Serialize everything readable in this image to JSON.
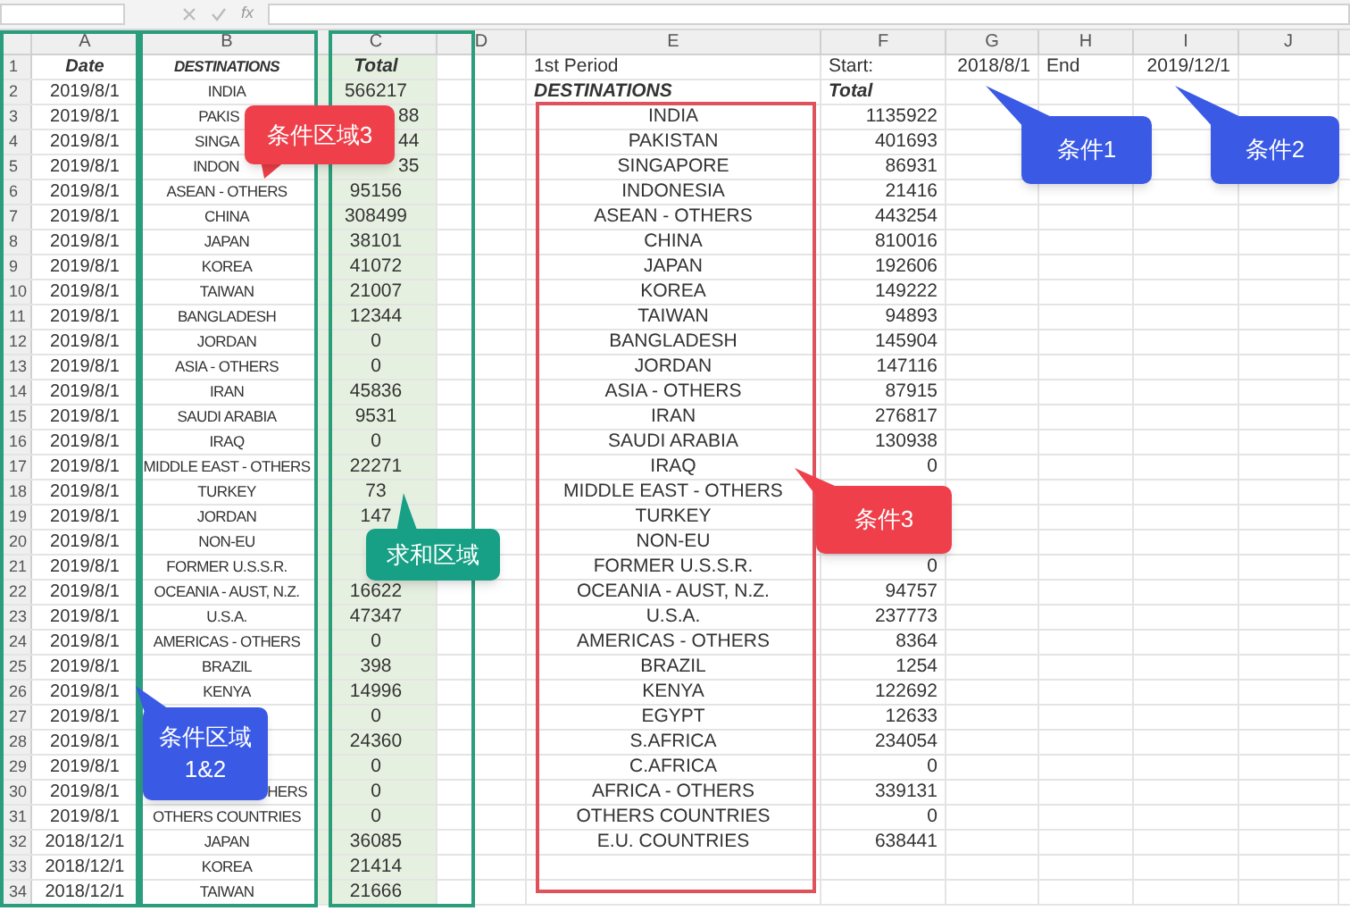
{
  "formula_bar": {
    "fx": "fx"
  },
  "columns": [
    "A",
    "B",
    "C",
    "D",
    "E",
    "F",
    "G",
    "H",
    "I",
    "J"
  ],
  "rows": [
    {
      "number": "1",
      "cells": {
        "A": "Date",
        "B": "DESTINATIONS",
        "C": "Total",
        "E": "1st Period",
        "F": "Start:",
        "G": "2018/8/1",
        "H": "End",
        "I": "2019/12/1"
      }
    },
    {
      "number": "2",
      "cells": {
        "A": "2019/8/1",
        "B": "INDIA",
        "C": "566217",
        "E": "DESTINATIONS",
        "F": "Total"
      }
    },
    {
      "number": "3",
      "cells": {
        "A": "2019/8/1",
        "B": "PAKIS",
        "C": "88",
        "E": "INDIA",
        "F": "1135922"
      }
    },
    {
      "number": "4",
      "cells": {
        "A": "2019/8/1",
        "B": "SINGA",
        "C": "44",
        "E": "PAKISTAN",
        "F": "401693"
      }
    },
    {
      "number": "5",
      "cells": {
        "A": "2019/8/1",
        "B": "INDON",
        "C": "35",
        "E": "SINGAPORE",
        "F": "86931"
      }
    },
    {
      "number": "6",
      "cells": {
        "A": "2019/8/1",
        "B": "ASEAN - OTHERS",
        "C": "95156",
        "E": "INDONESIA",
        "F": "21416"
      }
    },
    {
      "number": "7",
      "cells": {
        "A": "2019/8/1",
        "B": "CHINA",
        "C": "308499",
        "E": "ASEAN - OTHERS",
        "F": "443254"
      }
    },
    {
      "number": "8",
      "cells": {
        "A": "2019/8/1",
        "B": "JAPAN",
        "C": "38101",
        "E": "CHINA",
        "F": "810016"
      }
    },
    {
      "number": "9",
      "cells": {
        "A": "2019/8/1",
        "B": "KOREA",
        "C": "41072",
        "E": "JAPAN",
        "F": "192606"
      }
    },
    {
      "number": "10",
      "cells": {
        "A": "2019/8/1",
        "B": "TAIWAN",
        "C": "21007",
        "E": "KOREA",
        "F": "149222"
      }
    },
    {
      "number": "11",
      "cells": {
        "A": "2019/8/1",
        "B": "BANGLADESH",
        "C": "12344",
        "E": "TAIWAN",
        "F": "94893"
      }
    },
    {
      "number": "12",
      "cells": {
        "A": "2019/8/1",
        "B": "JORDAN",
        "C": "0",
        "E": "BANGLADESH",
        "F": "145904"
      }
    },
    {
      "number": "13",
      "cells": {
        "A": "2019/8/1",
        "B": "ASIA - OTHERS",
        "C": "0",
        "E": "JORDAN",
        "F": "147116"
      }
    },
    {
      "number": "14",
      "cells": {
        "A": "2019/8/1",
        "B": "IRAN",
        "C": "45836",
        "E": "ASIA - OTHERS",
        "F": "87915"
      }
    },
    {
      "number": "15",
      "cells": {
        "A": "2019/8/1",
        "B": "SAUDI ARABIA",
        "C": "9531",
        "E": "IRAN",
        "F": "276817"
      }
    },
    {
      "number": "16",
      "cells": {
        "A": "2019/8/1",
        "B": "IRAQ",
        "C": "0",
        "E": "SAUDI ARABIA",
        "F": "130938"
      }
    },
    {
      "number": "17",
      "cells": {
        "A": "2019/8/1",
        "B": "MIDDLE EAST - OTHERS",
        "C": "22271",
        "E": "IRAQ",
        "F": "0"
      }
    },
    {
      "number": "18",
      "cells": {
        "A": "2019/8/1",
        "B": "TURKEY",
        "C": "73",
        "E": "MIDDLE EAST - OTHERS"
      }
    },
    {
      "number": "19",
      "cells": {
        "A": "2019/8/1",
        "B": "JORDAN",
        "C": "147",
        "E": "TURKEY"
      }
    },
    {
      "number": "20",
      "cells": {
        "A": "2019/8/1",
        "B": "NON-EU",
        "E": "NON-EU"
      }
    },
    {
      "number": "21",
      "cells": {
        "A": "2019/8/1",
        "B": "FORMER U.S.S.R.",
        "E": "FORMER U.S.S.R.",
        "F": "0"
      }
    },
    {
      "number": "22",
      "cells": {
        "A": "2019/8/1",
        "B": "OCEANIA - AUST, N.Z.",
        "C": "16622",
        "E": "OCEANIA - AUST, N.Z.",
        "F": "94757"
      }
    },
    {
      "number": "23",
      "cells": {
        "A": "2019/8/1",
        "B": "U.S.A.",
        "C": "47347",
        "E": "U.S.A.",
        "F": "237773"
      }
    },
    {
      "number": "24",
      "cells": {
        "A": "2019/8/1",
        "B": "AMERICAS - OTHERS",
        "C": "0",
        "E": "AMERICAS - OTHERS",
        "F": "8364"
      }
    },
    {
      "number": "25",
      "cells": {
        "A": "2019/8/1",
        "B": "BRAZIL",
        "C": "398",
        "E": "BRAZIL",
        "F": "1254"
      }
    },
    {
      "number": "26",
      "cells": {
        "A": "2019/8/1",
        "B": "KENYA",
        "C": "14996",
        "E": "KENYA",
        "F": "122692"
      }
    },
    {
      "number": "27",
      "cells": {
        "A": "2019/8/1",
        "C": "0",
        "E": "EGYPT",
        "F": "12633"
      }
    },
    {
      "number": "28",
      "cells": {
        "A": "2019/8/1",
        "C": "24360",
        "E": "S.AFRICA",
        "F": "234054"
      }
    },
    {
      "number": "29",
      "cells": {
        "A": "2019/8/1",
        "C": "0",
        "E": "C.AFRICA",
        "F": "0"
      }
    },
    {
      "number": "30",
      "cells": {
        "A": "2019/8/1",
        "B": "HERS",
        "C": "0",
        "E": "AFRICA - OTHERS",
        "F": "339131"
      }
    },
    {
      "number": "31",
      "cells": {
        "A": "2019/8/1",
        "B": "OTHERS COUNTRIES",
        "C": "0",
        "E": "OTHERS COUNTRIES",
        "F": "0"
      }
    },
    {
      "number": "32",
      "cells": {
        "A": "2018/12/1",
        "B": "JAPAN",
        "C": "36085",
        "E": "E.U. COUNTRIES",
        "F": "638441"
      }
    },
    {
      "number": "33",
      "cells": {
        "A": "2018/12/1",
        "B": "KOREA",
        "C": "21414"
      }
    },
    {
      "number": "34",
      "cells": {
        "A": "2018/12/1",
        "B": "TAIWAN",
        "C": "21666"
      }
    }
  ],
  "callouts": [
    {
      "text": "条件区域3",
      "color": "#ee3f4a"
    },
    {
      "text": "求和区域",
      "color": "#17a085"
    },
    {
      "text": "条件区域 1&2",
      "color": "#3a5ae6"
    },
    {
      "text": "条件1",
      "color": "#3a5ae6"
    },
    {
      "text": "条件2",
      "color": "#3a5ae6"
    },
    {
      "text": "条件3",
      "color": "#ee3f4a"
    }
  ]
}
